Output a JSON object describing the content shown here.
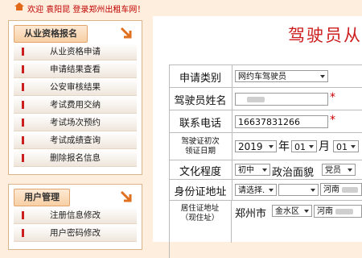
{
  "topbar": {
    "welcome_text": "欢迎 袁阳昆 登录郑州出租车网！"
  },
  "sidebar": {
    "sections": [
      {
        "title": "从业资格报名",
        "items": [
          {
            "label": "从业资格申请"
          },
          {
            "label": "申请结果查看"
          },
          {
            "label": "公安审核结果"
          },
          {
            "label": "考试费用交纳"
          },
          {
            "label": "考试场次预约"
          },
          {
            "label": "考试成绩查询"
          },
          {
            "label": "删除报名信息"
          }
        ]
      },
      {
        "title": "用户管理",
        "items": [
          {
            "label": "注册信息修改"
          },
          {
            "label": "用户密码修改"
          }
        ]
      }
    ]
  },
  "main": {
    "title": "驾驶员从",
    "form": {
      "application_type": {
        "label": "申请类别",
        "value": "网约车驾驶员"
      },
      "driver_name": {
        "label": "驾驶员姓名",
        "value": ""
      },
      "phone": {
        "label": "联系电话",
        "value": "16637831266"
      },
      "license_date": {
        "label_line1": "驾驶证初次",
        "label_line2": "领证日期",
        "year": "2019",
        "year_unit": "年",
        "month": "01",
        "month_unit": "月",
        "day": "01"
      },
      "education": {
        "label": "文化程度",
        "value": "初中"
      },
      "political": {
        "label": "政治面貌",
        "value": "党员"
      },
      "id_address": {
        "label": "身份证地址",
        "select_value": "请选择.",
        "text_value": "河南"
      },
      "residence": {
        "label_line1": "居住证地址",
        "label_line2": "（现住址）",
        "city": "郑州市",
        "district": "金水区",
        "text_value": "河南"
      },
      "required_mark": "*"
    }
  },
  "colors": {
    "accent": "#cc1e1e",
    "background": "#fdeedd",
    "panel_border": "#d9b48a"
  }
}
